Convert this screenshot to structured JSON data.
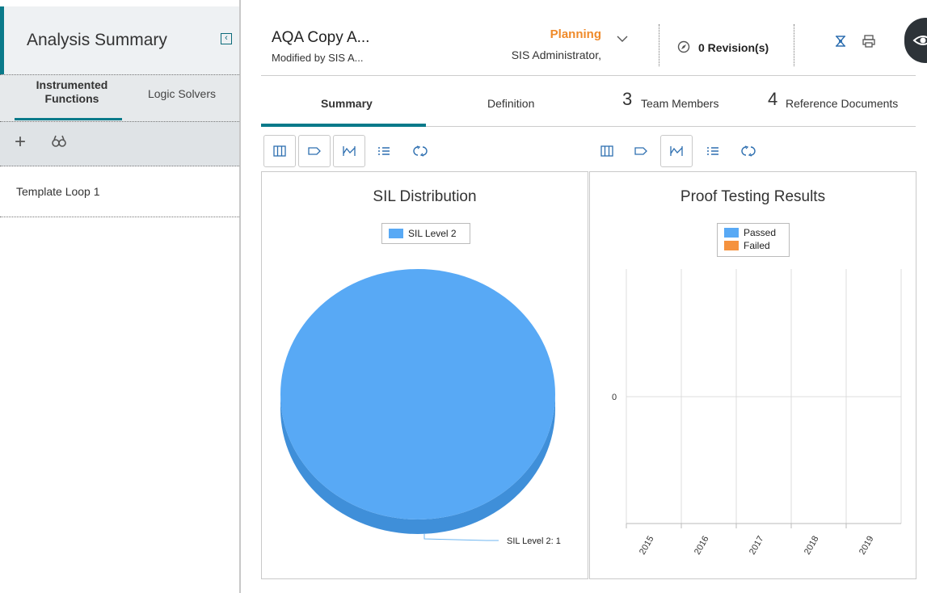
{
  "left_panel": {
    "title": "Analysis Summary",
    "tabs": {
      "instrumented_line1": "Instrumented",
      "instrumented_line2": "Functions",
      "logic_solvers": "Logic Solvers"
    },
    "list_items": [
      "Template Loop 1"
    ]
  },
  "header": {
    "record_title": "AQA Copy A...",
    "record_subtitle": "Modified by SIS A...",
    "state": "Planning",
    "state_user": "SIS Administrator,",
    "revisions": "0 Revision(s)"
  },
  "tabs": {
    "summary": "Summary",
    "definition": "Definition",
    "team_count": "3",
    "team_label": "Team Members",
    "ref_count": "4",
    "ref_label": "Reference Documents"
  },
  "colors": {
    "accent": "#0a7a8a",
    "state": "#ef8a2a",
    "series_blue": "#58a9f5",
    "series_orange": "#f5923e"
  },
  "chart_data": [
    {
      "type": "pie",
      "title": "SIL Distribution",
      "categories": [
        "SIL Level 2"
      ],
      "values": [
        1
      ],
      "data_labels": [
        "SIL Level 2: 1"
      ],
      "legend": [
        "SIL Level 2"
      ],
      "legend_position": "top-center"
    },
    {
      "type": "bar",
      "title": "Proof Testing Results",
      "categories": [
        "2015",
        "2016",
        "2017",
        "2018",
        "2019"
      ],
      "series": [
        {
          "name": "Passed",
          "values": [
            0,
            0,
            0,
            0,
            0
          ]
        },
        {
          "name": "Failed",
          "values": [
            0,
            0,
            0,
            0,
            0
          ]
        }
      ],
      "y_tick_labels": [
        "0"
      ],
      "legend_position": "top-center",
      "grid": true
    }
  ]
}
